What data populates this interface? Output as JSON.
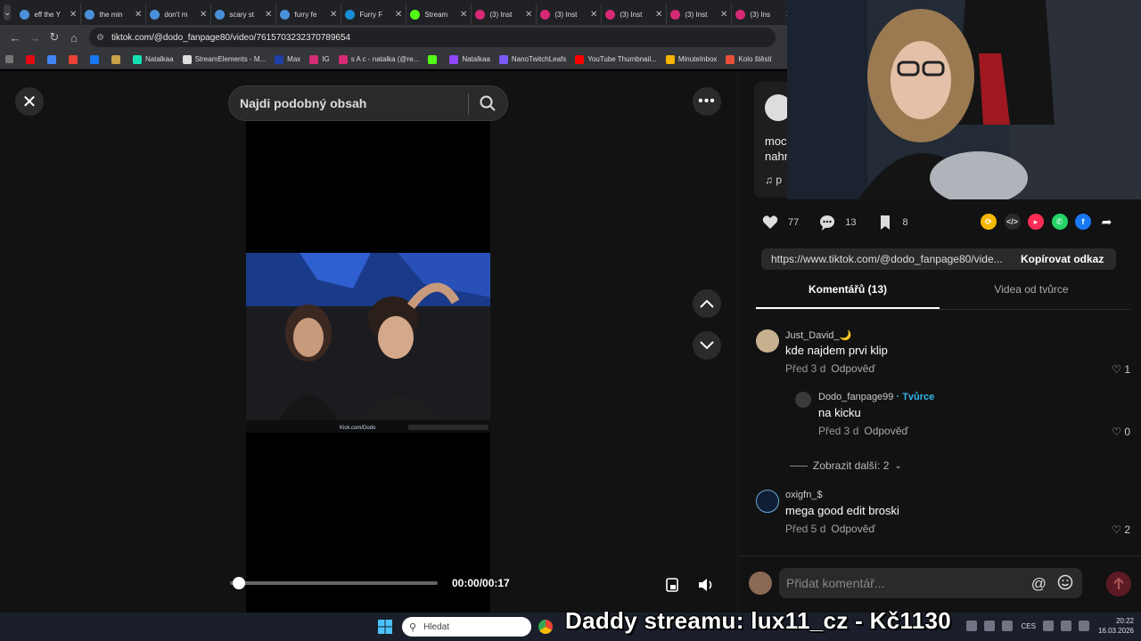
{
  "browser": {
    "tabs": [
      {
        "title": "eff the Y",
        "color": "#4a90d9"
      },
      {
        "title": "the min",
        "color": "#4a90d9"
      },
      {
        "title": "don't m",
        "color": "#4a90d9"
      },
      {
        "title": "scary st",
        "color": "#4a90d9"
      },
      {
        "title": "furry fe",
        "color": "#4a90d9"
      },
      {
        "title": "Furry F",
        "color": "#1b8dd8"
      },
      {
        "title": "Stream",
        "color": "#53fc18"
      },
      {
        "title": "(3) Inst",
        "color": "#d62976"
      },
      {
        "title": "(3) Inst",
        "color": "#d62976"
      },
      {
        "title": "(3) Inst",
        "color": "#d62976"
      },
      {
        "title": "(3) Inst",
        "color": "#d62976"
      },
      {
        "title": "(3) Ins",
        "color": "#d62976"
      }
    ],
    "tab_close_glyph": "✕",
    "url": "tiktok.com/@dodo_fanpage80/video/7615703232370789654",
    "bookmarks": [
      {
        "label": "",
        "color": "#e50914"
      },
      {
        "label": "",
        "color": "#4285f4"
      },
      {
        "label": "",
        "color": "#ea4335"
      },
      {
        "label": "",
        "color": "#1877f2"
      },
      {
        "label": "",
        "color": "#c9a14a"
      },
      {
        "label": "Natalkaa",
        "color": "#18e0b5"
      },
      {
        "label": "StreamElements - M...",
        "color": "#ddd"
      },
      {
        "label": "Max",
        "color": "#1f3fa8"
      },
      {
        "label": "IG",
        "color": "#d62976"
      },
      {
        "label": "s A c - natalka (@re...",
        "color": "#d62976"
      },
      {
        "label": "",
        "color": "#53fc18"
      },
      {
        "label": "Natalkaa",
        "color": "#9146ff"
      },
      {
        "label": "NanoTwitchLeafs",
        "color": "#7a5af8"
      },
      {
        "label": "YouTube Thumbnail...",
        "color": "#ff0000"
      },
      {
        "label": "MinuteInbox",
        "color": "#f4b400"
      },
      {
        "label": "Kolo štěstí",
        "color": "#e94f3b"
      }
    ]
  },
  "video": {
    "search_placeholder": "Najdi podobný obsah",
    "timecode": "00:00/00:17",
    "progress": 0.02
  },
  "sidebar": {
    "desc_line1": "moc",
    "desc_line2": "nahr",
    "desc_music": "♫  p",
    "likes": "77",
    "comments_count": "13",
    "saves": "8",
    "link": "https://www.tiktok.com/@dodo_fanpage80/vide...",
    "copy_label": "Kopírovat odkaz",
    "tab_comments": "Komentářů (13)",
    "tab_creator_videos": "Videa od tvůrce",
    "comments": [
      {
        "name": "Just_David_🌙",
        "text": "kde najdem prvi klip",
        "time": "Před 3 d",
        "reply": "Odpověď",
        "likes": "1"
      },
      {
        "name": "Dodo_fanpage99",
        "creator": "· Tvůrce",
        "text": "na kicku",
        "time": "Před 3 d",
        "reply": "Odpověď",
        "likes": "0"
      },
      {
        "name": "oxigfn_$",
        "text": "mega good edit broski",
        "time": "Před 5 d",
        "reply": "Odpověď",
        "likes": "2"
      }
    ],
    "more_replies": "Zobrazit další: 2",
    "comment_placeholder": "Přidat komentář..."
  },
  "taskbar": {
    "search": "Hledat",
    "donation": "Daddy streamu: lux11_cz - Kč1130",
    "lang": "CES",
    "time": "20:22",
    "date": "16.03.2026"
  }
}
